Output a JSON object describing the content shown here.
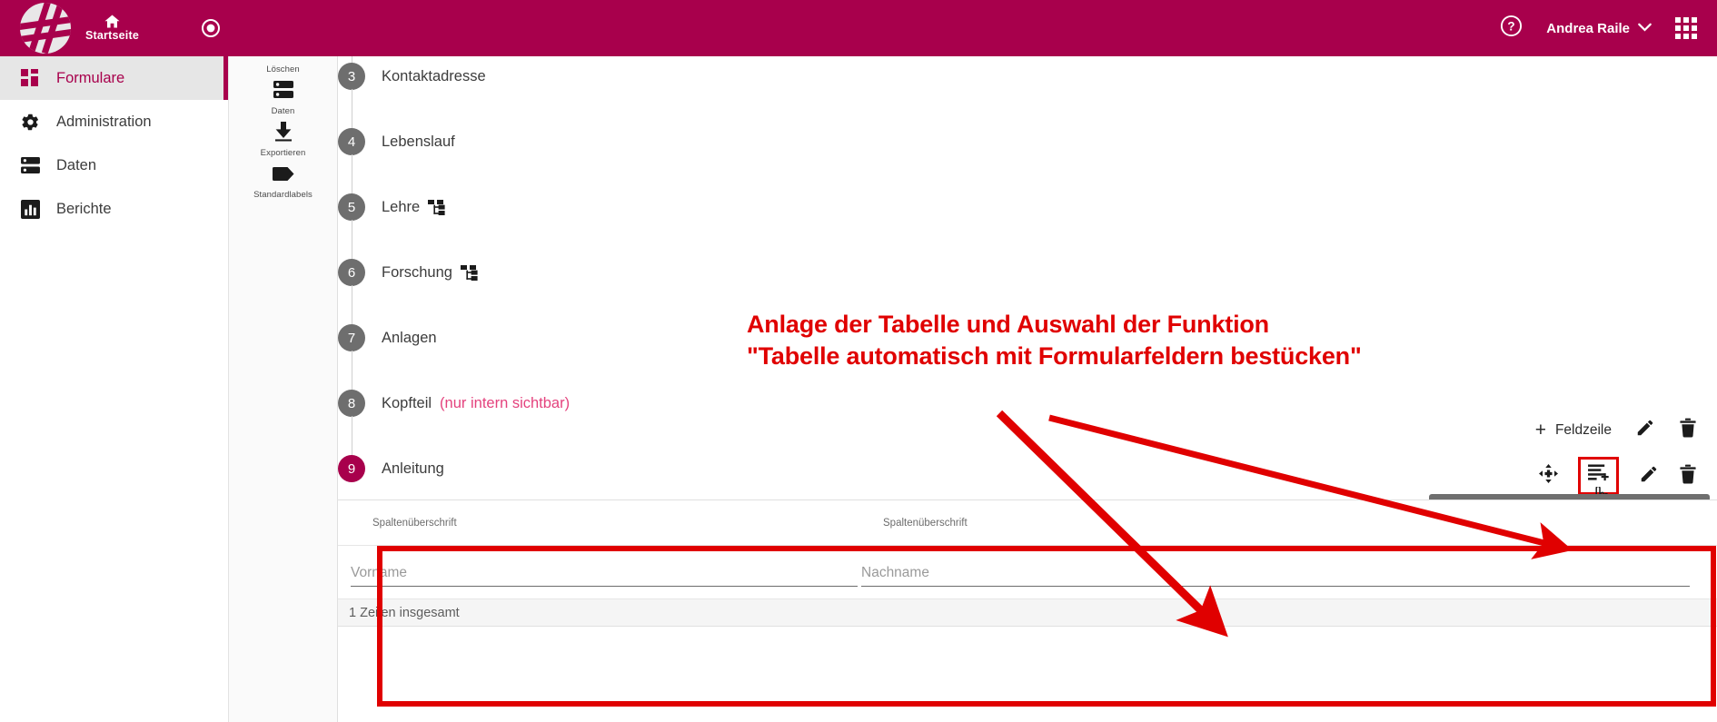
{
  "header": {
    "logo_name": "application-logo",
    "home_label": "Startseite",
    "record_icon": "record-circle-icon",
    "help_icon": "help-circle-icon",
    "user_name": "Andrea Raile",
    "chevron_icon": "chevron-down-icon",
    "apps_icon": "apps-grid-icon",
    "brand_color": "#a8004c"
  },
  "sidebar": {
    "items": [
      {
        "label": "Formulare",
        "icon": "forms-icon",
        "active": true
      },
      {
        "label": "Administration",
        "icon": "gear-icon",
        "active": false
      },
      {
        "label": "Daten",
        "icon": "server-icon",
        "active": false
      },
      {
        "label": "Berichte",
        "icon": "chart-bar-icon",
        "active": false
      }
    ]
  },
  "toolcolumn": {
    "items": [
      {
        "label": "Löschen",
        "icon": "trash-icon"
      },
      {
        "label": "Daten",
        "icon": "server-icon"
      },
      {
        "label": "Exportieren",
        "icon": "download-icon"
      },
      {
        "label": "Standardlabels",
        "icon": "tag-icon"
      }
    ]
  },
  "stepper": {
    "steps": [
      {
        "number": "3",
        "label": "Kontaktadresse",
        "note": "",
        "icon": "",
        "current": false
      },
      {
        "number": "4",
        "label": "Lebenslauf",
        "note": "",
        "icon": "",
        "current": false
      },
      {
        "number": "5",
        "label": "Lehre",
        "note": "",
        "icon": "sitemap-icon",
        "current": false
      },
      {
        "number": "6",
        "label": "Forschung",
        "note": "",
        "icon": "sitemap-icon",
        "current": false
      },
      {
        "number": "7",
        "label": "Anlagen",
        "note": "",
        "icon": "",
        "current": false
      },
      {
        "number": "8",
        "label": "Kopfteil",
        "note": "(nur intern sichtbar)",
        "icon": "",
        "current": false
      },
      {
        "number": "9",
        "label": "Anleitung",
        "note": "",
        "icon": "",
        "current": true
      }
    ]
  },
  "row_toolbar": {
    "add_row_label": "Feldzeile",
    "add_row_plus": "+",
    "edit_icon": "pencil-icon",
    "delete_icon": "trash-icon"
  },
  "table_toolbar": {
    "move_icon": "move-arrows-icon",
    "autofill_icon": "table-autofill-icon",
    "edit_icon": "pencil-icon",
    "delete_icon": "trash-icon",
    "highlight_color": "#e00000",
    "tooltip": "Tabelle automatisch mit Formularfeldern bestücken"
  },
  "table": {
    "headers": [
      "Spaltenüberschrift",
      "Spaltenüberschrift"
    ],
    "rows": [
      {
        "cells": [
          {
            "value": "",
            "placeholder": "Vorname"
          },
          {
            "value": "",
            "placeholder": "Nachname"
          }
        ]
      }
    ],
    "footer": "1 Zeilen insgesamt"
  },
  "annotation": {
    "line1": "Anlage der Tabelle und Auswahl der Funktion",
    "line2": "\"Tabelle automatisch mit Formularfeldern bestücken\"",
    "color": "#e00000"
  }
}
